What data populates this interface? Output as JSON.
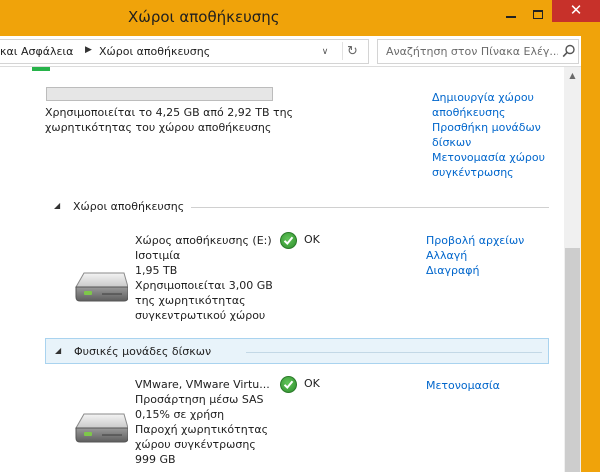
{
  "window": {
    "title": "Χώροι αποθήκευσης",
    "close_glyph": "✕"
  },
  "address": {
    "breadcrumb": [
      "και Ασφάλεια",
      "Χώροι αποθήκευσης"
    ],
    "search_placeholder": "Αναζήτηση στον Πίνακα Ελέγ..."
  },
  "pool": {
    "usage_line1": "Χρησιμοποιείται το 4,25 GB από 2,92 TB της",
    "usage_line2": "χωρητικότητας του χώρου αποθήκευσης",
    "used_fraction": 0.0014,
    "links": [
      "Δημιουργία χώρου",
      "αποθήκευσης",
      "Προσθήκη μονάδων",
      "δίσκων",
      "Μετονομασία χώρου",
      "συγκέντρωσης"
    ]
  },
  "sections": {
    "spaces": {
      "label": "Χώροι αποθήκευσης"
    },
    "drives": {
      "label": "Φυσικές μονάδες δίσκων"
    }
  },
  "space_item": {
    "lines": [
      "Χώρος αποθήκευσης (E:)",
      "Ισοτιμία",
      "1,95 TB",
      "Χρησιμοποιείται 3,00 GB",
      "της χωρητικότητας",
      "συγκεντρωτικού χώρου"
    ],
    "status": "OK",
    "links": [
      "Προβολή αρχείων",
      "Αλλαγή",
      "Διαγραφή"
    ]
  },
  "drive_item": {
    "lines": [
      "VMware, VMware Virtu...",
      "Προσάρτηση μέσω SAS",
      "0,15% σε χρήση",
      "Παροχή χωρητικότητας",
      "χώρου συγκέντρωσης",
      "999 GB"
    ],
    "status": "OK",
    "links": [
      "Μετονομασία"
    ]
  },
  "colors": {
    "accent": "#f0a30a",
    "close": "#c7312a",
    "link": "#0066cc",
    "ok": "#2e8f2c"
  }
}
